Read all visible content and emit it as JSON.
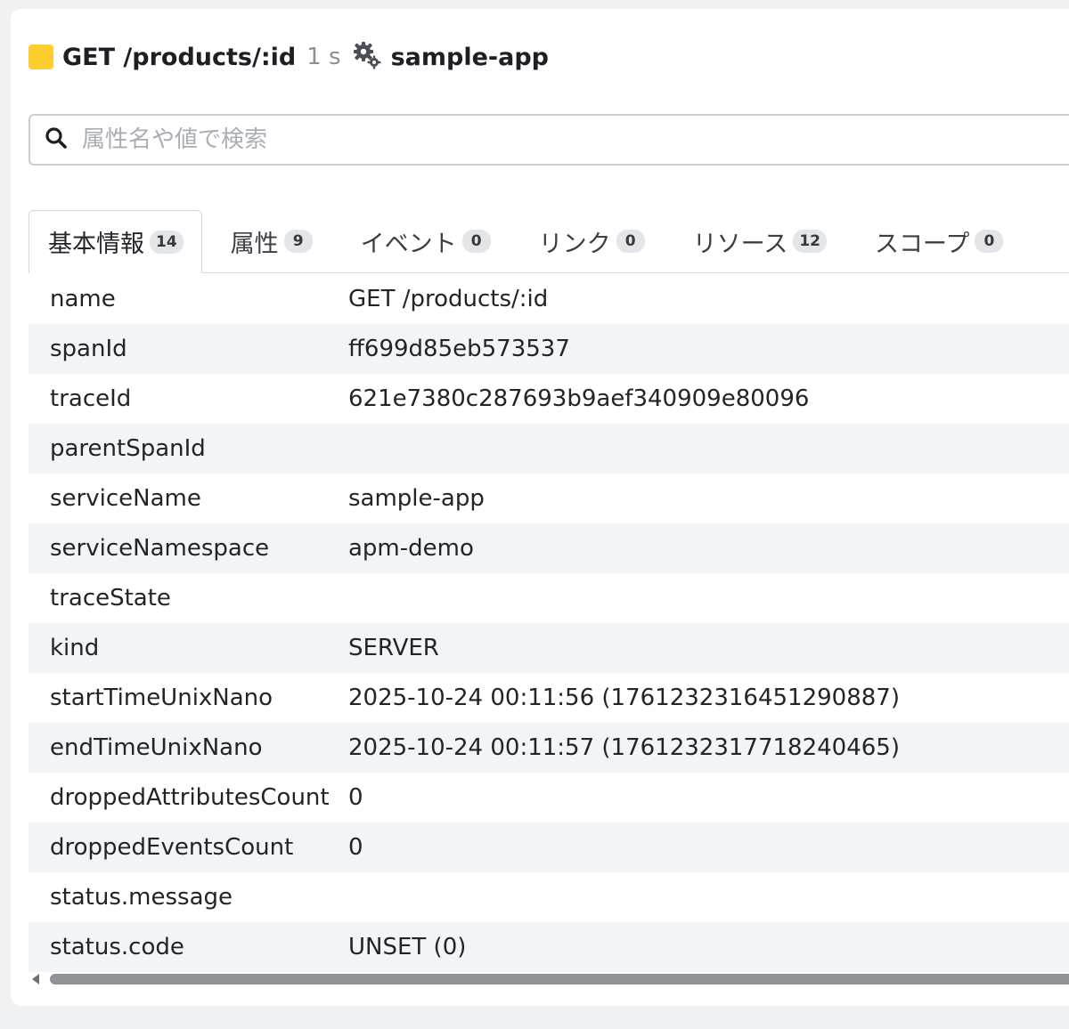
{
  "header": {
    "color": "#ffcd2e",
    "span_name": "GET /products/:id",
    "duration": "1 s",
    "service_icon": "gears-icon",
    "service_name": "sample-app"
  },
  "search": {
    "placeholder": "属性名や値で検索",
    "value": ""
  },
  "tabs": [
    {
      "label": "基本情報",
      "count": "14",
      "active": true
    },
    {
      "label": "属性",
      "count": "9"
    },
    {
      "label": "イベント",
      "count": "0"
    },
    {
      "label": "リンク",
      "count": "0"
    },
    {
      "label": "リソース",
      "count": "12"
    },
    {
      "label": "スコープ",
      "count": "0"
    }
  ],
  "rows": [
    {
      "key": "name",
      "value": "GET /products/:id"
    },
    {
      "key": "spanId",
      "value": "ff699d85eb573537"
    },
    {
      "key": "traceId",
      "value": "621e7380c287693b9aef340909e80096"
    },
    {
      "key": "parentSpanId",
      "value": ""
    },
    {
      "key": "serviceName",
      "value": "sample-app"
    },
    {
      "key": "serviceNamespace",
      "value": "apm-demo"
    },
    {
      "key": "traceState",
      "value": ""
    },
    {
      "key": "kind",
      "value": "SERVER"
    },
    {
      "key": "startTimeUnixNano",
      "value": "2025-10-24 00:11:56 (1761232316451290887)"
    },
    {
      "key": "endTimeUnixNano",
      "value": "2025-10-24 00:11:57 (1761232317718240465)"
    },
    {
      "key": "droppedAttributesCount",
      "value": "0"
    },
    {
      "key": "droppedEventsCount",
      "value": "0"
    },
    {
      "key": "status.message",
      "value": ""
    },
    {
      "key": "status.code",
      "value": "UNSET (0)"
    }
  ]
}
